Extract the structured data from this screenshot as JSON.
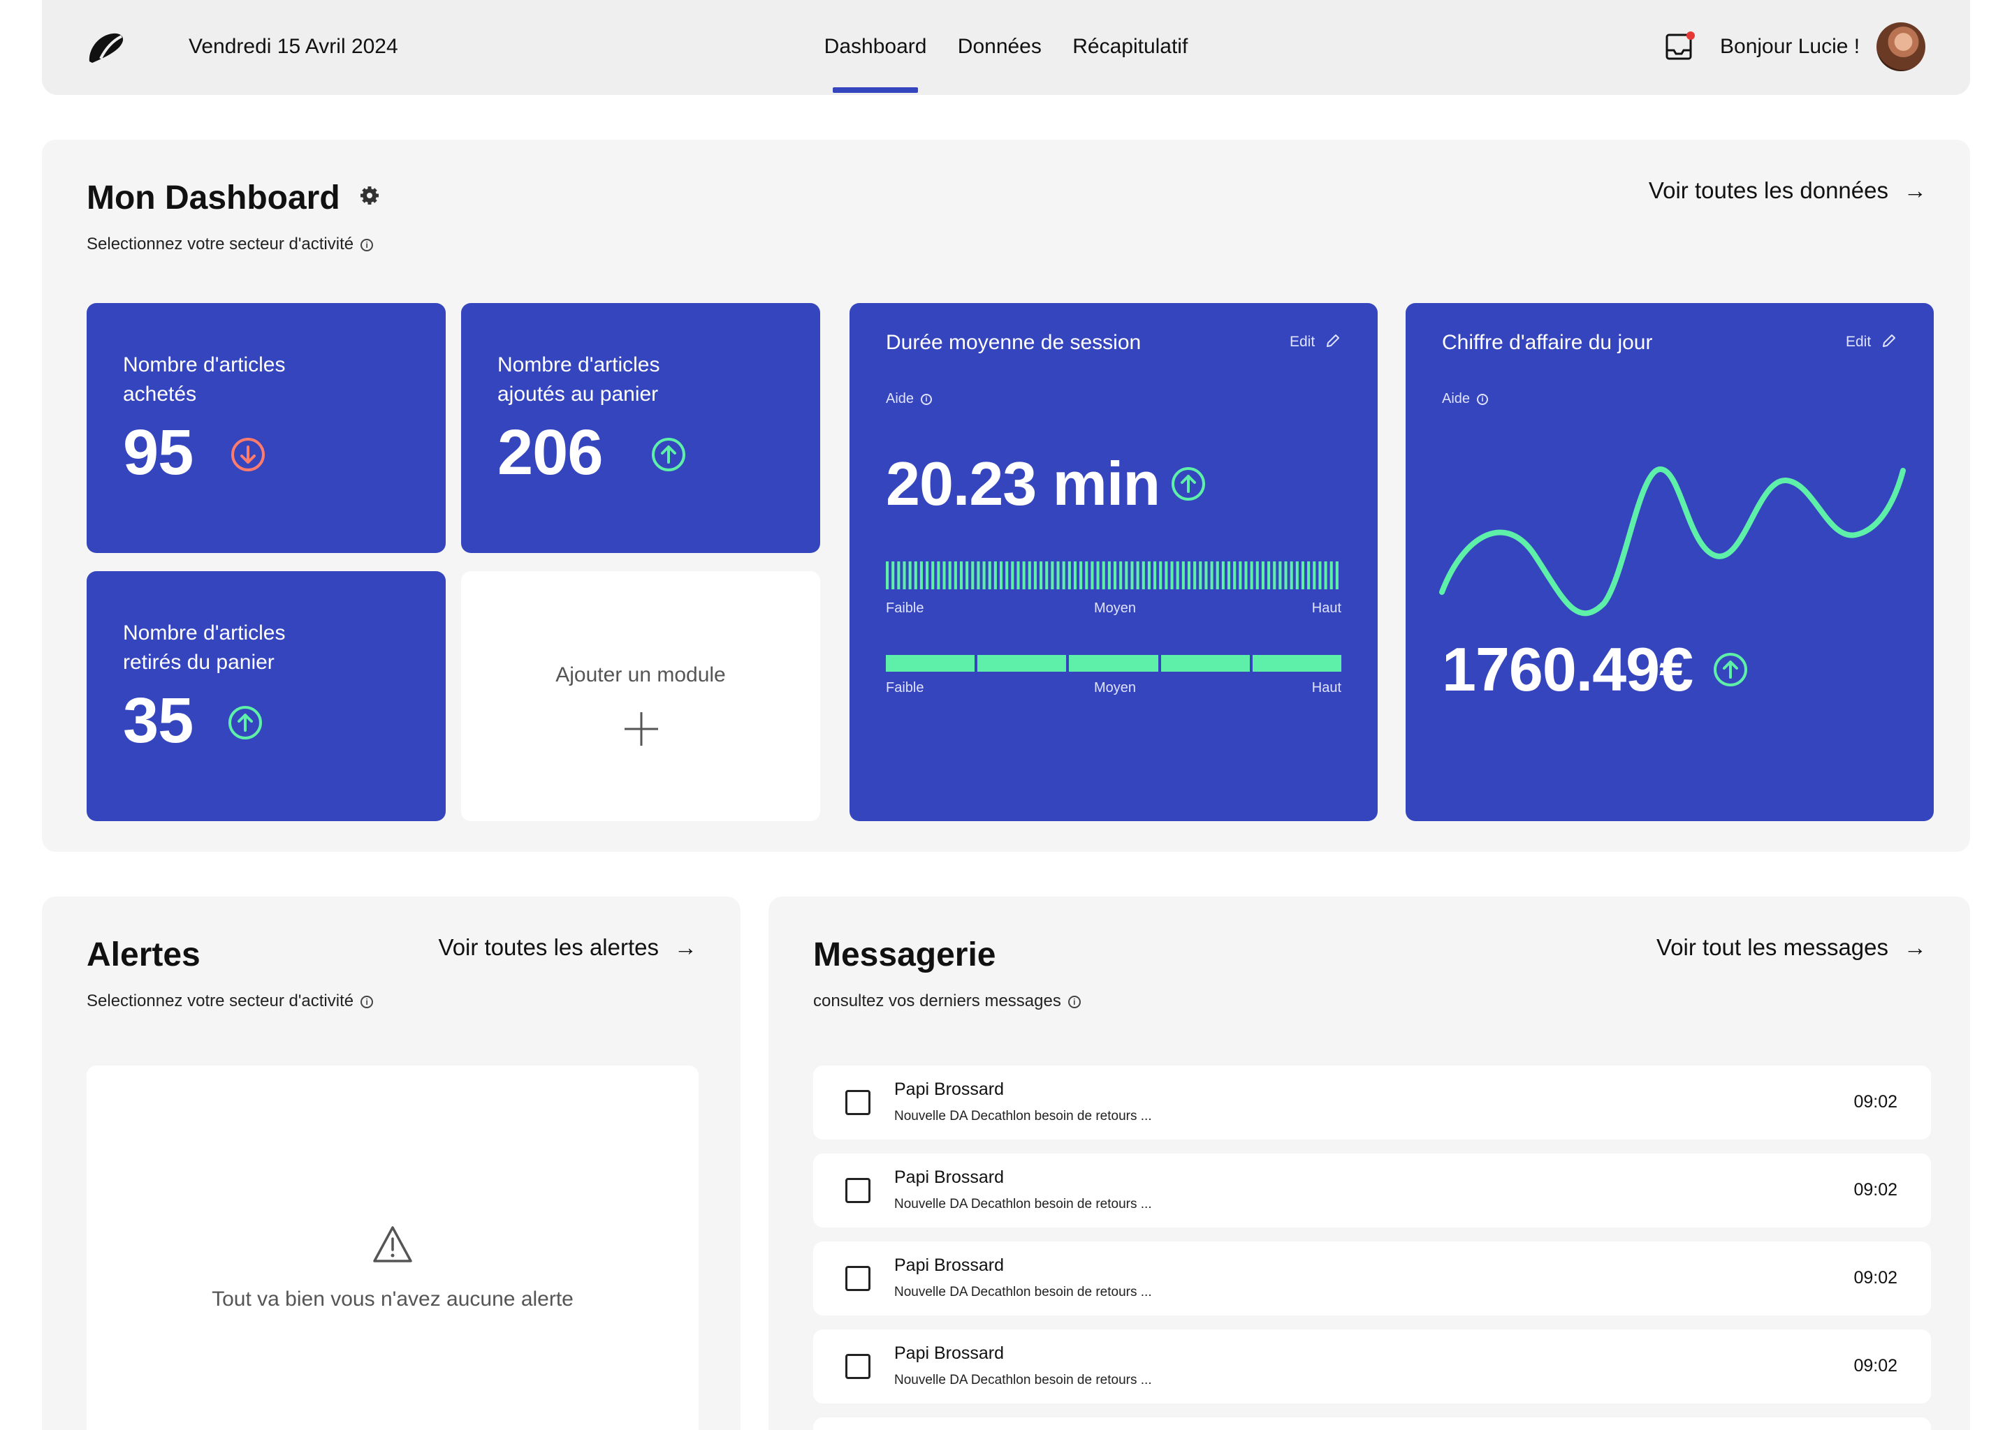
{
  "header": {
    "date": "Vendredi 15 Avril 2024",
    "nav": [
      {
        "label": "Dashboard",
        "active": true
      },
      {
        "label": "Données",
        "active": false
      },
      {
        "label": "Récapitulatif",
        "active": false
      }
    ],
    "greeting": "Bonjour Lucie !",
    "notification_color": "#e53935"
  },
  "dashboard": {
    "title": "Mon Dashboard",
    "subtitle": "Selectionnez votre secteur d'activité",
    "link": "Voir toutes les données",
    "cards": {
      "bought": {
        "label": "Nombre d'articles achetés",
        "value": "95",
        "trend": "down"
      },
      "added": {
        "label": "Nombre d'articles ajoutés au panier",
        "value": "206",
        "trend": "up"
      },
      "removed": {
        "label": "Nombre d'articles retirés du panier",
        "value": "35",
        "trend": "up"
      },
      "add_module": {
        "label": "Ajouter un module"
      },
      "session": {
        "title": "Durée moyenne de session",
        "edit": "Edit",
        "aide": "Aide",
        "value": "20.23 min",
        "trend": "up",
        "scale": [
          "Faible",
          "Moyen",
          "Haut"
        ]
      },
      "revenue": {
        "title": "Chiffre d'affaire du jour",
        "edit": "Edit",
        "aide": "Aide",
        "value": "1760.49€",
        "trend": "up"
      }
    },
    "accent": "#3545bd",
    "positive_color": "#5ef0a8",
    "negative_color": "#ff7b6b"
  },
  "alerts": {
    "title": "Alertes",
    "subtitle": "Selectionnez votre secteur d'activité",
    "link": "Voir toutes les alertes",
    "empty_text": "Tout va bien vous n'avez aucune alerte"
  },
  "messages": {
    "title": "Messagerie",
    "subtitle": "consultez vos derniers messages",
    "link": "Voir tout les messages",
    "items": [
      {
        "sender": "Papi Brossard",
        "preview": "Nouvelle DA Decathlon besoin de retours ...",
        "time": "09:02"
      },
      {
        "sender": "Papi Brossard",
        "preview": "Nouvelle DA Decathlon besoin de retours ...",
        "time": "09:02"
      },
      {
        "sender": "Papi Brossard",
        "preview": "Nouvelle DA Decathlon besoin de retours ...",
        "time": "09:02"
      },
      {
        "sender": "Papi Brossard",
        "preview": "Nouvelle DA Decathlon besoin de retours ...",
        "time": "09:02"
      }
    ]
  }
}
